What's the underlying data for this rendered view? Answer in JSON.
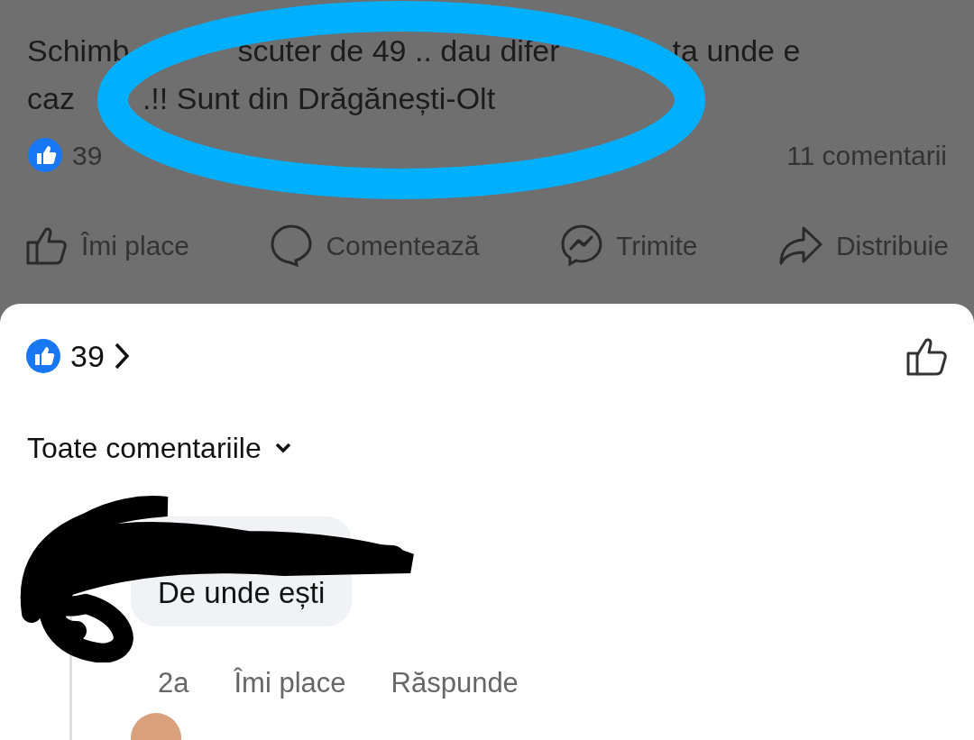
{
  "post": {
    "text_lines": [
      [
        "Schimb",
        "scuter de 49 .. dau difer",
        "ta unde e"
      ],
      [
        "caz",
        ".!! Sunt din Drăgănești-Olt"
      ]
    ],
    "reactions_count": "39",
    "comments_count": "11 comentarii",
    "actions": [
      {
        "kind": "like",
        "label": "Îmi place"
      },
      {
        "kind": "comment",
        "label": "Comentează"
      },
      {
        "kind": "send",
        "label": "Trimite"
      },
      {
        "kind": "share",
        "label": "Distribuie"
      }
    ]
  },
  "sheet": {
    "reactions_count": "39",
    "filter": "Toate comentariile",
    "comments": [
      {
        "text": "De unde ești",
        "time": "2a",
        "like": "Îmi place",
        "reply": "Răspunde"
      }
    ]
  }
}
